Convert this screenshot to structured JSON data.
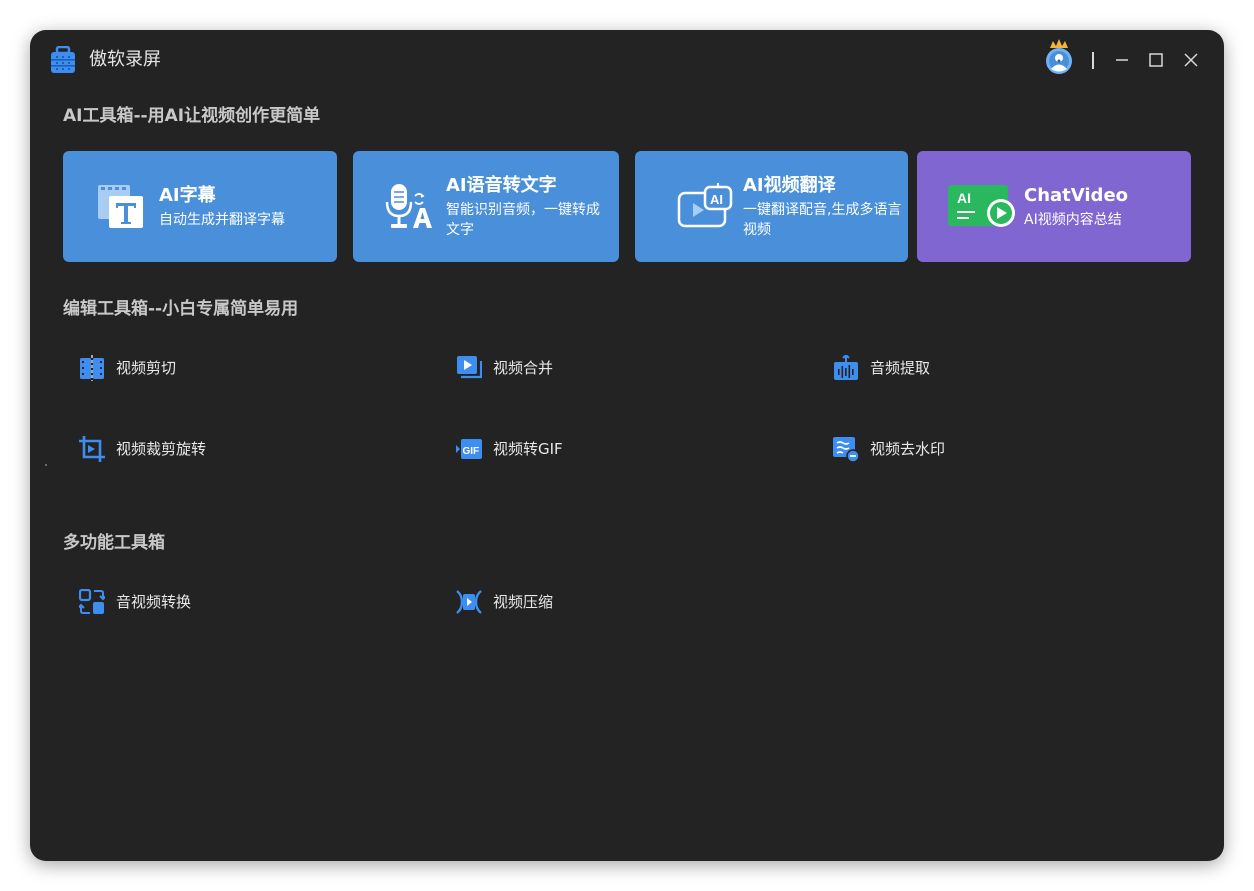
{
  "app": {
    "title": "傲软录屏"
  },
  "sections": {
    "ai": "AI工具箱--用AI让视频创作更简单",
    "edit": "编辑工具箱--小白专属简单易用",
    "multi": "多功能工具箱"
  },
  "ai_cards": [
    {
      "title": "AI字幕",
      "desc": "自动生成并翻译字幕",
      "icon": "subtitle-icon",
      "color": "#4a8fd9"
    },
    {
      "title": "AI语音转文字",
      "desc": "智能识别音频，一键转成文字",
      "icon": "speech-to-text-icon",
      "color": "#4a8fd9"
    },
    {
      "title": "AI视频翻译",
      "desc": "一键翻译配音,生成多语言视频",
      "icon": "video-translate-icon",
      "color": "#4a8fd9"
    },
    {
      "title": "ChatVideo",
      "desc": "AI视频内容总结",
      "icon": "chatvideo-icon",
      "color": "#8066d0"
    }
  ],
  "edit_tools": [
    {
      "label": "视频剪切",
      "icon": "video-cut-icon"
    },
    {
      "label": "视频合并",
      "icon": "video-merge-icon"
    },
    {
      "label": "音频提取",
      "icon": "audio-extract-icon"
    },
    {
      "label": "视频裁剪旋转",
      "icon": "video-crop-rotate-icon"
    },
    {
      "label": "视频转GIF",
      "icon": "video-to-gif-icon"
    },
    {
      "label": "视频去水印",
      "icon": "watermark-remove-icon"
    }
  ],
  "multi_tools": [
    {
      "label": "音视频转换",
      "icon": "format-convert-icon"
    },
    {
      "label": "视频压缩",
      "icon": "video-compress-icon"
    }
  ],
  "colors": {
    "background": "#232323",
    "accent_blue": "#4a8fd9",
    "accent_purple": "#8066d0",
    "icon_blue": "#3d8ef0"
  }
}
